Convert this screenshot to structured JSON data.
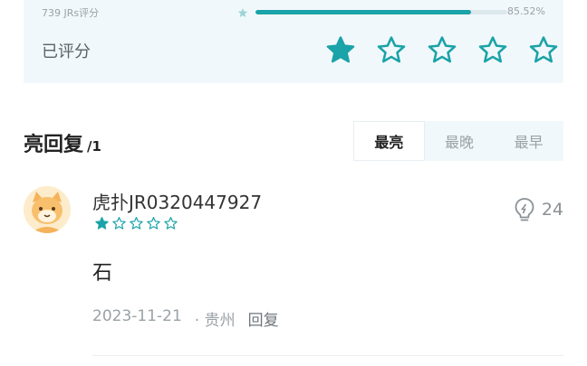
{
  "rating_card": {
    "jrs_count_text": "739 JRs评分",
    "bar_percent_text": "85.52%",
    "bar_fill_fraction": 0.8552,
    "rated_label": "已评分",
    "user_rating": 1,
    "max_rating": 5
  },
  "comments": {
    "title": "亮回复",
    "count_text": "/1",
    "sort_tabs": [
      {
        "label": "最亮",
        "active": true
      },
      {
        "label": "最晚",
        "active": false
      },
      {
        "label": "最早",
        "active": false
      }
    ],
    "items": [
      {
        "username": "虎扑JR0320447927",
        "rating": 1,
        "like_count": "24",
        "text": "石",
        "date": "2023-11-21",
        "location": "· 贵州",
        "reply_label": "回复"
      }
    ]
  },
  "colors": {
    "accent": "#1aa3a8",
    "card_bg": "#f1f8fb",
    "muted_text": "#9aa2a6"
  },
  "icons": {
    "star": "star-icon",
    "like": "lightbulb-icon",
    "avatar": "cat-avatar"
  }
}
